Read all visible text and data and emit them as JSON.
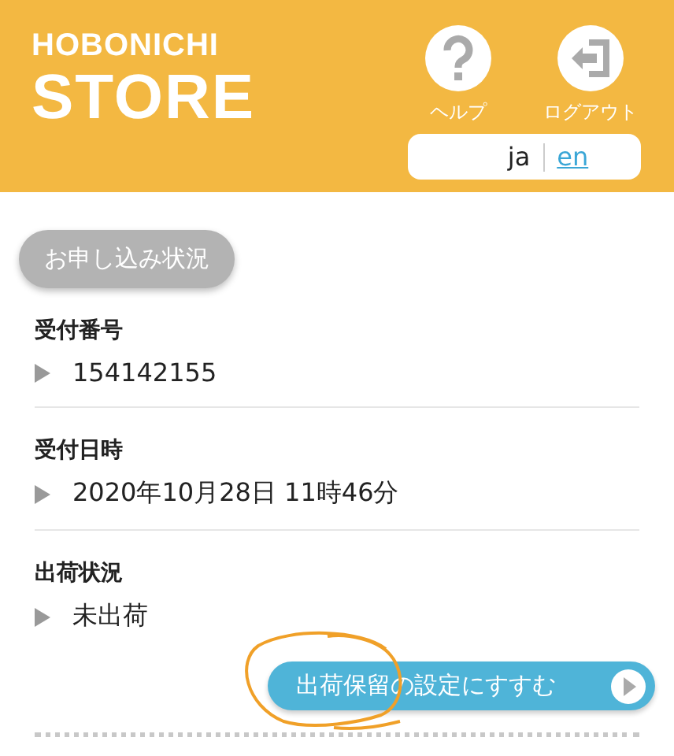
{
  "header": {
    "logo_top": "HOBONICHI",
    "logo_bottom": "STORE",
    "actions": [
      {
        "kind": "help",
        "label": "ヘルプ"
      },
      {
        "kind": "logout",
        "label": "ログアウト"
      }
    ],
    "languages": [
      {
        "label": "ja",
        "selected": true
      },
      {
        "label": "en",
        "selected": false
      }
    ]
  },
  "section_badge": "お申し込み状況",
  "fields": [
    {
      "label": "受付番号",
      "value": "154142155"
    },
    {
      "label": "受付日時",
      "value": "2020年10月28日 11時46分"
    },
    {
      "label": "出荷状況",
      "value": "未出荷"
    }
  ],
  "action_button": "出荷保留の設定にすすむ"
}
